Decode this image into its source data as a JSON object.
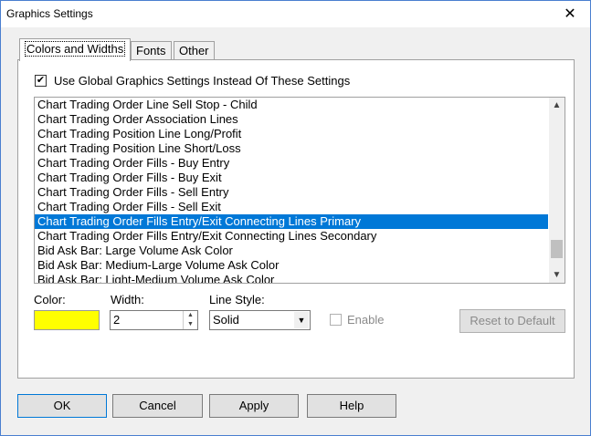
{
  "window": {
    "title": "Graphics Settings",
    "close_glyph": "✕"
  },
  "tabs": [
    {
      "label": "Colors and Widths",
      "active": true
    },
    {
      "label": "Fonts",
      "active": false
    },
    {
      "label": "Other",
      "active": false
    }
  ],
  "global_settings": {
    "label": "Use Global Graphics Settings Instead Of These Settings",
    "checked": true,
    "check_glyph": "✔"
  },
  "items_list": {
    "items": [
      "Chart Trading Order Line Sell Stop - Child",
      "Chart Trading Order Association Lines",
      "Chart Trading Position Line Long/Profit",
      "Chart Trading Position Line Short/Loss",
      "Chart Trading Order Fills - Buy Entry",
      "Chart Trading Order Fills - Buy Exit",
      "Chart Trading Order Fills - Sell Entry",
      "Chart Trading Order Fills - Sell Exit",
      "Chart Trading Order Fills Entry/Exit Connecting Lines Primary",
      "Chart Trading Order Fills Entry/Exit Connecting Lines Secondary",
      "Bid Ask Bar: Large Volume Ask Color",
      "Bid Ask Bar: Medium-Large Volume Ask Color",
      "Bid Ask Bar: Light-Medium Volume Ask Color"
    ],
    "selected_index": 8,
    "scroll_up_glyph": "▲",
    "scroll_down_glyph": "▼"
  },
  "color": {
    "label": "Color:",
    "value_hex": "#ffff00"
  },
  "width": {
    "label": "Width:",
    "value": "2",
    "up_glyph": "▲",
    "down_glyph": "▼"
  },
  "line_style": {
    "label": "Line Style:",
    "value": "Solid",
    "dropdown_glyph": "▼"
  },
  "enable": {
    "label": "Enable",
    "checked": false,
    "disabled": true
  },
  "reset_button": {
    "label": "Reset to Default",
    "disabled": true
  },
  "footer": {
    "ok": "OK",
    "cancel": "Cancel",
    "apply": "Apply",
    "help": "Help"
  },
  "colors": {
    "selection": "#0078d7",
    "desktop": "#2a5fb4",
    "dialog_bg": "#f0f0f0"
  }
}
